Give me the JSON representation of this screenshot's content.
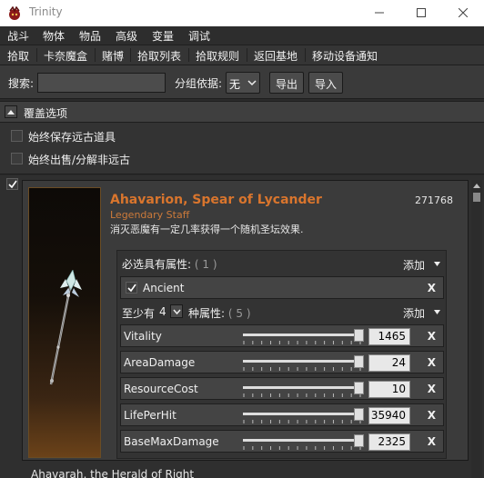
{
  "window": {
    "title": "Trinity"
  },
  "menu": [
    "战斗",
    "物体",
    "物品",
    "高级",
    "变量",
    "调试"
  ],
  "tabs": [
    "拾取",
    "卡奈魔盒",
    "赌博",
    "拾取列表",
    "拾取规则",
    "返回基地",
    "移动设备通知"
  ],
  "search": {
    "label": "搜索:",
    "value": "",
    "group_label": "分组依据:",
    "group_value": "无",
    "export_label": "导出",
    "import_label": "导入"
  },
  "overrides": {
    "title": "覆盖选项",
    "options": [
      {
        "label": "始终保存远古道具",
        "checked": false
      },
      {
        "label": "始终出售/分解非远古",
        "checked": false
      }
    ]
  },
  "item": {
    "checked": true,
    "name": "Ahavarion, Spear of Lycander",
    "type": "Legendary Staff",
    "description": "消灭恶魔有一定几率获得一个随机圣坛效果.",
    "id": "271768",
    "required": {
      "label": "必选具有属性:",
      "count": "( 1 )",
      "add_label": "添加",
      "rows": [
        {
          "name": "Ancient",
          "checked": true,
          "remove": "X"
        }
      ]
    },
    "at_least": {
      "prefix": "至少有",
      "number": "4",
      "suffix": "种属性:",
      "count": "( 5 )",
      "add_label": "添加",
      "rows": [
        {
          "name": "Vitality",
          "value": "1465",
          "level": 1.0,
          "remove": "X"
        },
        {
          "name": "AreaDamage",
          "value": "24",
          "level": 1.0,
          "remove": "X"
        },
        {
          "name": "ResourceCost",
          "value": "10",
          "level": 1.0,
          "remove": "X"
        },
        {
          "name": "LifePerHit",
          "value": "35940",
          "level": 1.0,
          "remove": "X"
        },
        {
          "name": "BaseMaxDamage",
          "value": "2325",
          "level": 1.0,
          "remove": "X"
        }
      ]
    }
  },
  "next_item": {
    "name": "Ahavarah, the Herald of Right"
  },
  "colors": {
    "accent": "#d9752d",
    "item_type": "#cc7a3a",
    "background": "#2b2b2b"
  },
  "icons": {
    "app": "trinity-icon",
    "minimize": "minimize-icon",
    "maximize": "maximize-icon",
    "close": "close-icon"
  }
}
